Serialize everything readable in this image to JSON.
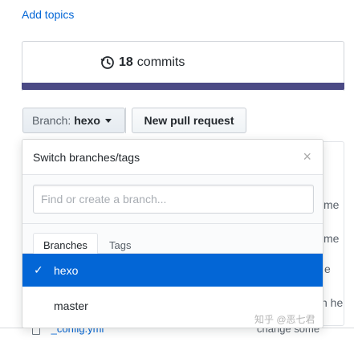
{
  "add_topics": "Add topics",
  "commits": {
    "count": "18",
    "label": "commits",
    "icon": "history-icon"
  },
  "colors": {
    "link": "#0366d6",
    "lang_bar": "#4b4a85",
    "selected_bg": "#0366d6"
  },
  "branch_button": {
    "label": "Branch:",
    "value": "hexo"
  },
  "new_pr_button": "New pull request",
  "dropdown": {
    "title": "Switch branches/tags",
    "close": "×",
    "filter_placeholder": "Find or create a branch...",
    "tabs": [
      "Branches",
      "Tags"
    ],
    "items": [
      {
        "label": "hexo",
        "selected": true,
        "check": "✓"
      },
      {
        "label": "master",
        "selected": false
      }
    ]
  },
  "background_fragments": [
    "me",
    "me",
    "e",
    "h he"
  ],
  "bottom_row": {
    "file": "_config.yml",
    "message": "change some"
  },
  "watermark": "知乎 @恶七君"
}
